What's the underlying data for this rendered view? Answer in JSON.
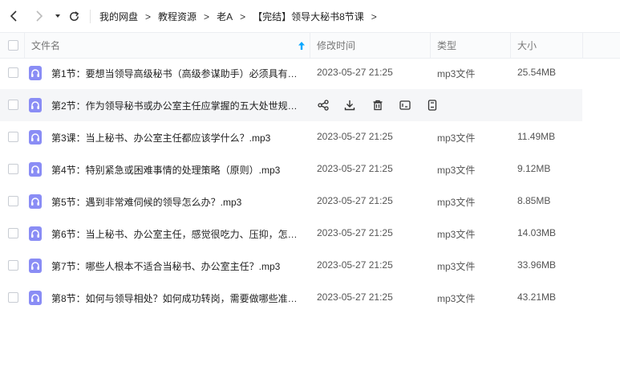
{
  "breadcrumb": {
    "items": [
      "我的网盘",
      "教程资源",
      "老A",
      "【完结】领导大秘书8节课"
    ],
    "separator": ">"
  },
  "table": {
    "columns": {
      "name": "文件名",
      "modified": "修改时间",
      "type": "类型",
      "size": "大小"
    },
    "rows": [
      {
        "name": "第1节：要想当领导高级秘书（高级参谋助手）必须具有…",
        "modified": "2023-05-27 21:25",
        "type": "mp3文件",
        "size": "25.54MB"
      },
      {
        "name": "第2节：作为领导秘书或办公室主任应掌握的五大处世规…",
        "modified": "",
        "type": "",
        "size": ""
      },
      {
        "name": "第3课：当上秘书、办公室主任都应该学什么？.mp3",
        "modified": "2023-05-27 21:25",
        "type": "mp3文件",
        "size": "11.49MB"
      },
      {
        "name": "第4节：特别紧急或困难事情的处理策略（原则）.mp3",
        "modified": "2023-05-27 21:25",
        "type": "mp3文件",
        "size": "9.12MB"
      },
      {
        "name": "第5节：遇到非常难伺候的领导怎么办？.mp3",
        "modified": "2023-05-27 21:25",
        "type": "mp3文件",
        "size": "8.85MB"
      },
      {
        "name": "第6节：当上秘书、办公室主任，感觉很吃力、压抑，怎…",
        "modified": "2023-05-27 21:25",
        "type": "mp3文件",
        "size": "14.03MB"
      },
      {
        "name": "第7节：哪些人根本不适合当秘书、办公室主任？.mp3",
        "modified": "2023-05-27 21:25",
        "type": "mp3文件",
        "size": "33.96MB"
      },
      {
        "name": "第8节：如何与领导相处？如何成功转岗，需要做哪些准…",
        "modified": "2023-05-27 21:25",
        "type": "mp3文件",
        "size": "43.21MB"
      }
    ]
  },
  "row_actions": [
    "share-icon",
    "download-icon",
    "delete-icon",
    "rename-icon",
    "more-icon"
  ],
  "colors": {
    "accent": "#06a7ff",
    "file_icon": "#8a8df5",
    "hover_row": "#f5f6f8"
  }
}
